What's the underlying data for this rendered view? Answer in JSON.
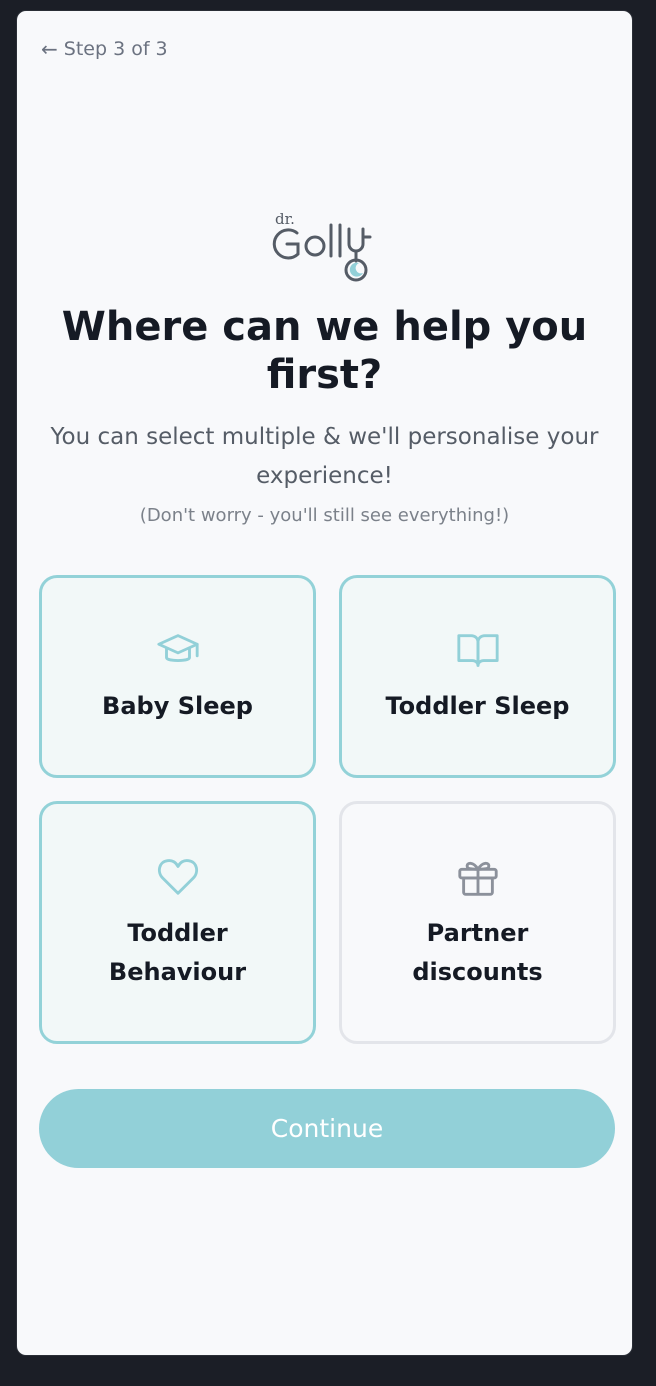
{
  "header": {
    "back_label": "Step 3 of 3"
  },
  "logo": {
    "small_text": "dr."
  },
  "main": {
    "heading": "Where can we help you first?",
    "subtitle": "You can select multiple & we'll personalise your experience!",
    "note": "(Don't worry - you'll still see everything!)"
  },
  "options": [
    {
      "label": "Baby Sleep",
      "icon": "graduation-cap-icon",
      "selected": true
    },
    {
      "label": "Toddler Sleep",
      "icon": "open-book-icon",
      "selected": true
    },
    {
      "label": "Toddler Behaviour",
      "icon": "heart-icon",
      "selected": true
    },
    {
      "label": "Partner discounts",
      "icon": "gift-icon",
      "selected": false
    }
  ],
  "continue_label": "Continue",
  "colors": {
    "accent": "#92d0d8",
    "selected_border": "#93d2d8",
    "selected_bg": "#f2f8f8",
    "heading": "#151a24",
    "background": "#f8f9fb"
  }
}
